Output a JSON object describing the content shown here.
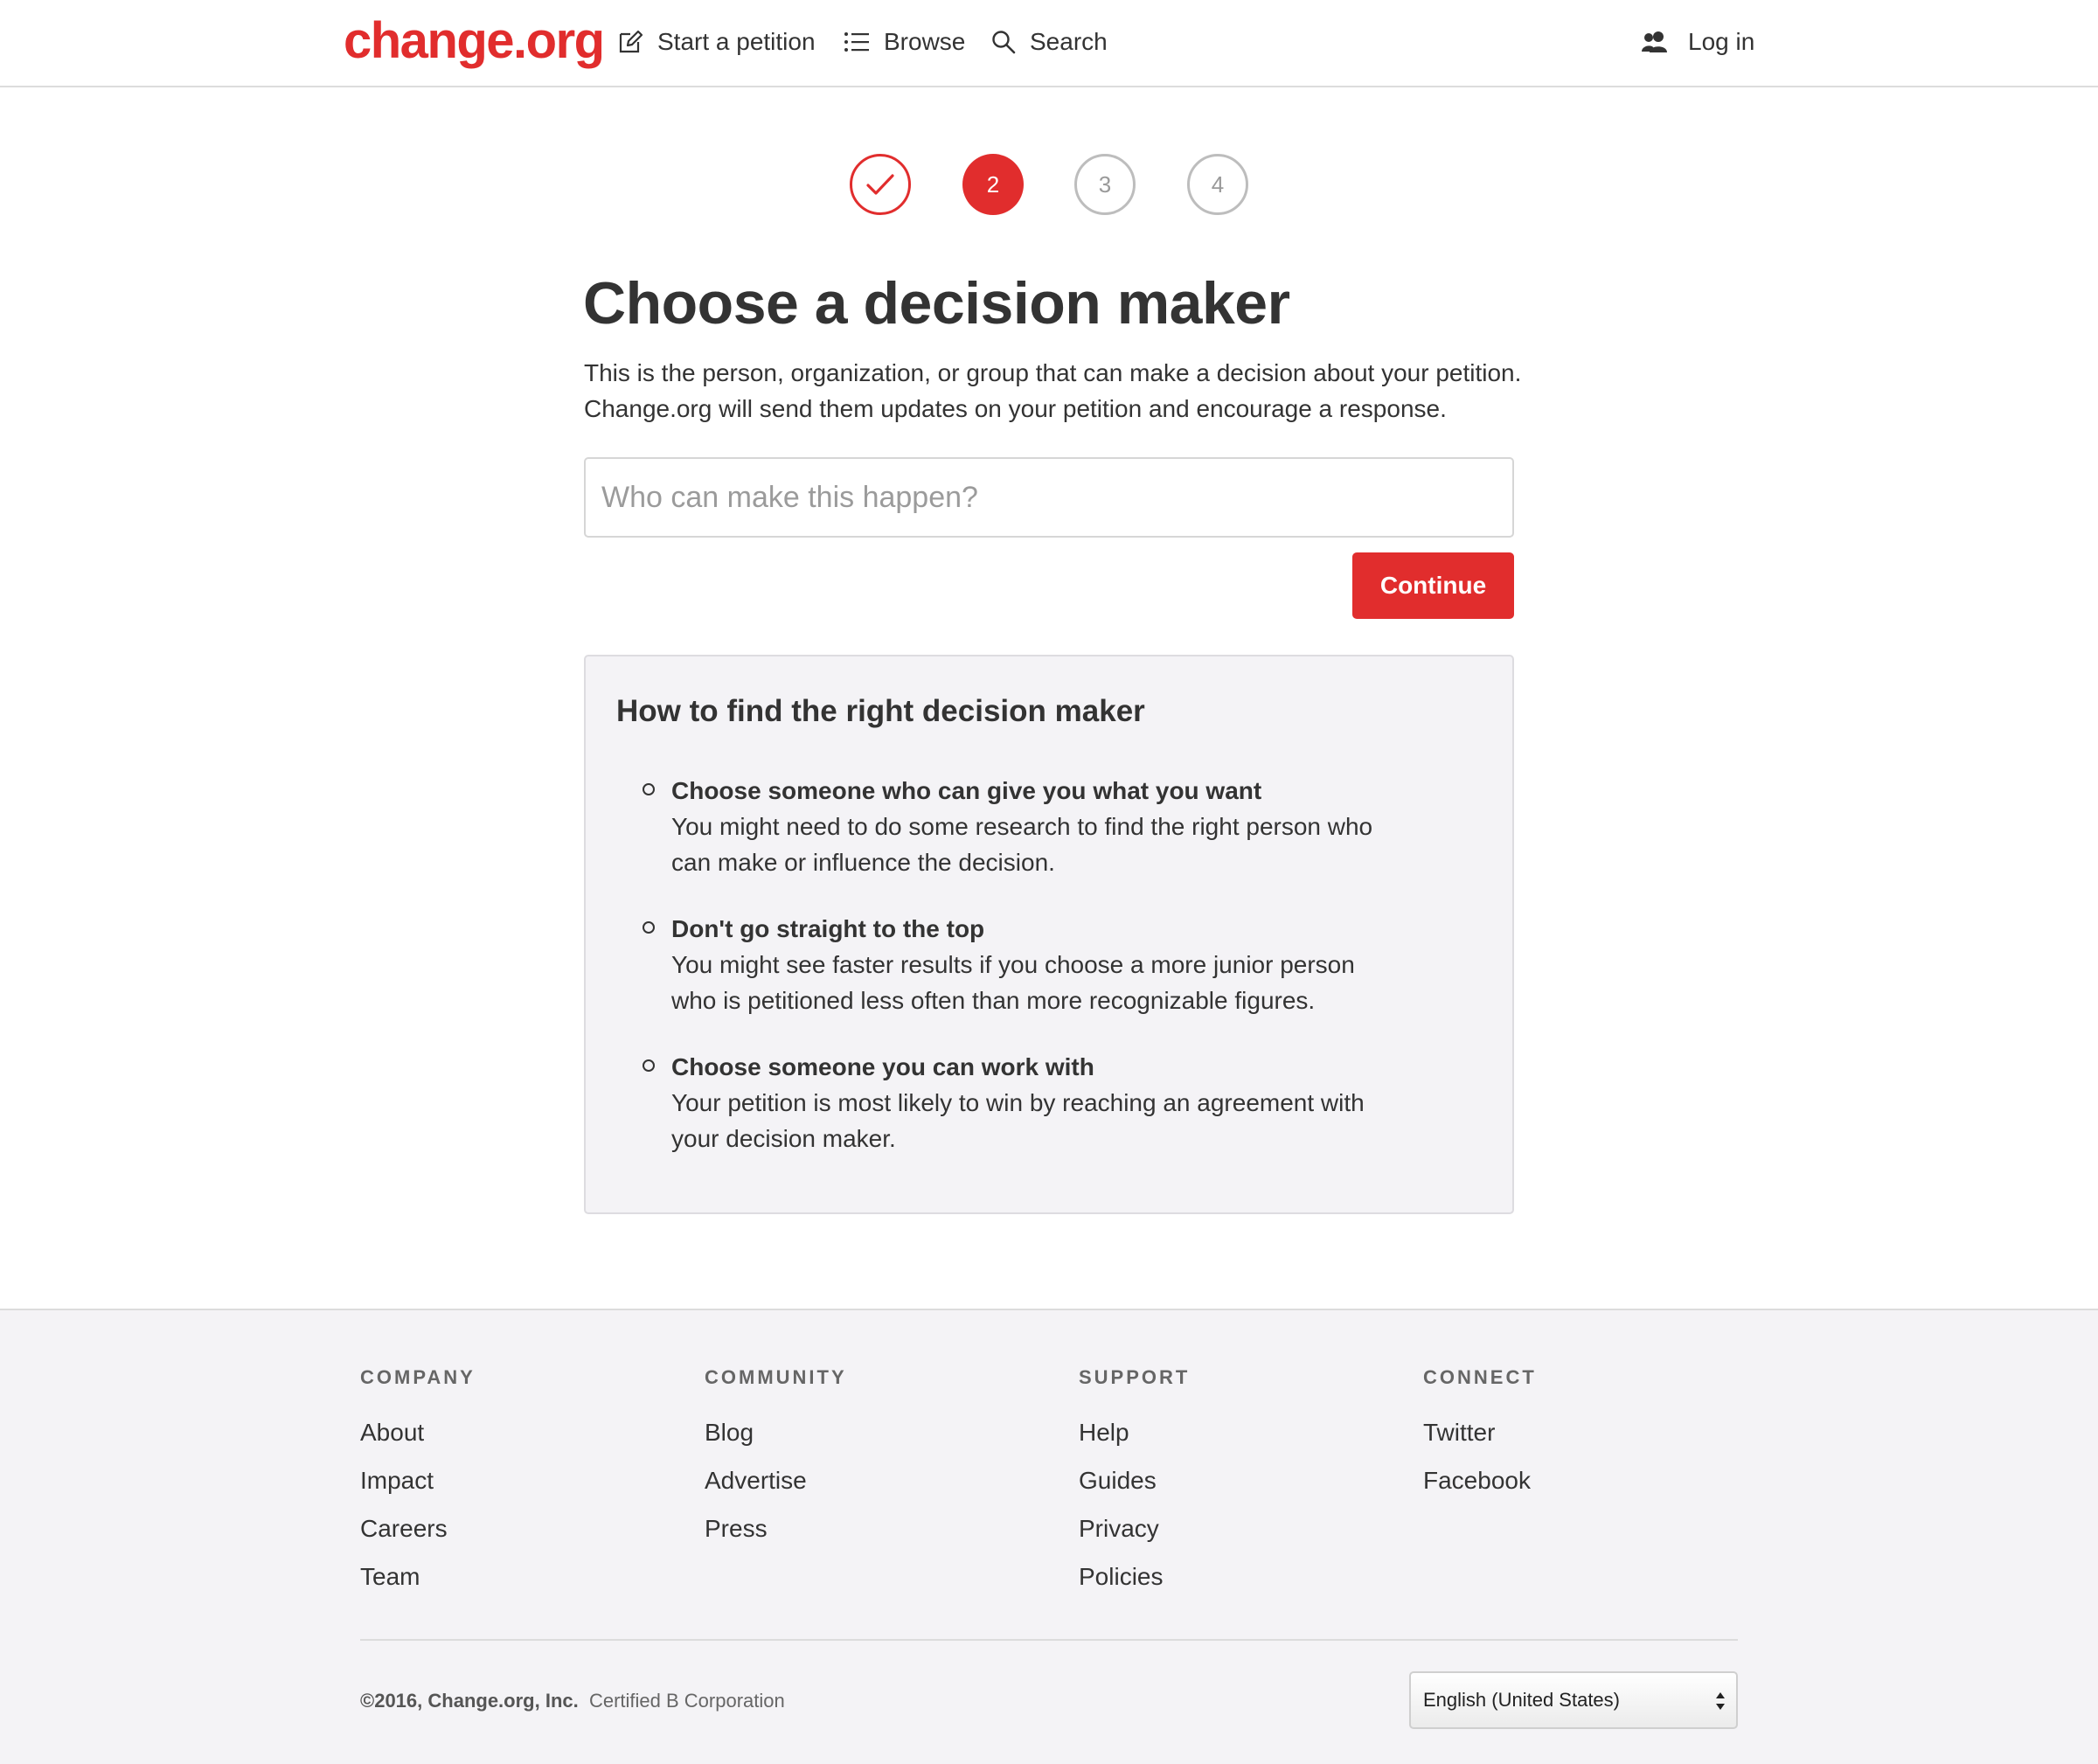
{
  "header": {
    "logo": "change.org",
    "nav": {
      "start_petition": "Start a petition",
      "browse": "Browse",
      "search": "Search",
      "login": "Log in"
    }
  },
  "steps": {
    "current": 2,
    "items": [
      "✓",
      "2",
      "3",
      "4"
    ]
  },
  "main": {
    "title": "Choose a decision maker",
    "intro_line1": "This is the person, organization, or group that can make a decision about your petition.",
    "intro_line2": "Change.org will send them updates on your petition and encourage a response.",
    "input_placeholder": "Who can make this happen?",
    "input_value": "",
    "continue_label": "Continue"
  },
  "tips": {
    "title": "How to find the right decision maker",
    "items": [
      {
        "heading": "Choose someone who can give you what you want",
        "body": "You might need to do some research to find the right person who can make or influence the decision."
      },
      {
        "heading": "Don't go straight to the top",
        "body": "You might see faster results if you choose a more junior person who is petitioned less often than more recognizable figures."
      },
      {
        "heading": "Choose someone you can work with",
        "body": "Your petition is most likely to win by reaching an agreement with your decision maker."
      }
    ]
  },
  "footer": {
    "columns": [
      {
        "heading": "COMPANY",
        "links": [
          "About",
          "Impact",
          "Careers",
          "Team"
        ]
      },
      {
        "heading": "COMMUNITY",
        "links": [
          "Blog",
          "Advertise",
          "Press"
        ]
      },
      {
        "heading": "SUPPORT",
        "links": [
          "Help",
          "Guides",
          "Privacy",
          "Policies"
        ]
      },
      {
        "heading": "CONNECT",
        "links": [
          "Twitter",
          "Facebook"
        ]
      }
    ],
    "copyright": "©2016, Change.org, Inc.",
    "certified": "Certified B Corporation",
    "language": "English (United States)"
  },
  "colors": {
    "brand_red": "#e12d2d",
    "text": "#333333",
    "footer_bg": "#f4f3f6"
  },
  "icons": {
    "start_petition": "edit-icon",
    "browse": "list-icon",
    "search": "search-icon",
    "login": "users-icon",
    "step_done": "check-icon"
  }
}
